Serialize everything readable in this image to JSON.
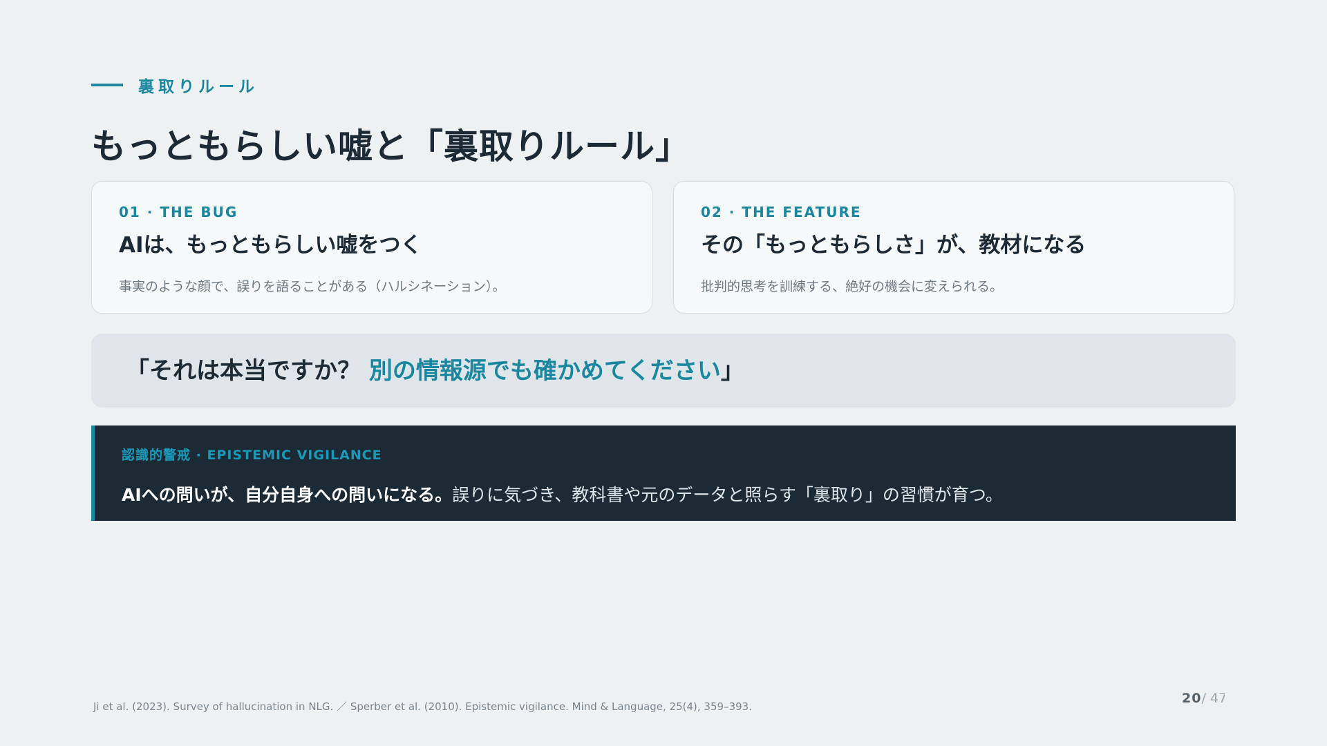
{
  "eyebrow": {
    "text": "裏取りルール"
  },
  "title": "もっともらしい嘘と「裏取りルール」",
  "cards": [
    {
      "label": "01 · THE BUG",
      "heading": "AIは、もっともらしい嘘をつく",
      "desc": "事実のような顔で、誤りを語ることがある（ハルシネーション）。"
    },
    {
      "label": "02 · THE FEATURE",
      "heading": "その「もっともらしさ」が、教材になる",
      "desc": "批判的思考を訓練する、絶好の機会に変えられる。"
    }
  ],
  "quote": {
    "open": "「それは本当ですか？ ",
    "accent": "別の情報源でも確かめてください",
    "close": "」"
  },
  "vigilance": {
    "label": "認識的警戒 · EPISTEMIC VIGILANCE",
    "strong": "AIへの問いが、自分自身への問いになる。",
    "normal": "誤りに気づき、教科書や元のデータと照らす「裏取り」の習慣が育つ。"
  },
  "footer": "Ji et al. (2023). Survey of hallucination in NLG. ／ Sperber et al. (2010). Epistemic vigilance. Mind & Language, 25(4), 359–393.",
  "page": {
    "current": "20",
    "total": "/ 47"
  },
  "colors": {
    "accent": "#1a87a1",
    "dark": "#1b2a35",
    "background": "#edf1f2"
  }
}
